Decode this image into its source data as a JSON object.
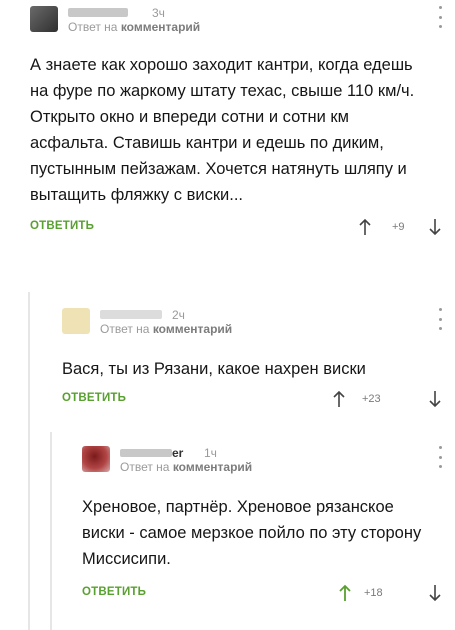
{
  "comments": [
    {
      "username": "",
      "time": "3ч",
      "reply_prefix": "Ответ на",
      "reply_target": "комментарий",
      "text": "А знаете как хорошо заходит кантри, когда едешь на фуре по жаркому штату техас, свыше 110 км/ч. Открыто окно и впереди сотни и сотни км асфальта. Ставишь кантри и едешь по диким, пустынным пейзажам. Хочется натянуть шляпу и вытащить фляжку с виски...",
      "reply_label": "ОТВЕТИТЬ",
      "score": "+9"
    },
    {
      "username": "",
      "time": "2ч",
      "reply_prefix": "Ответ на",
      "reply_target": "комментарий",
      "text": "Вася, ты из Рязани, какое нахрен виски",
      "reply_label": "ОТВЕТИТЬ",
      "score": "+23"
    },
    {
      "username": "er",
      "time": "1ч",
      "reply_prefix": "Ответ на",
      "reply_target": "комментарий",
      "text": "Хреновое, партнёр. Хреновое рязанское виски - самое мерзкое пойло по эту сторону Миссисипи.",
      "reply_label": "ОТВЕТИТЬ",
      "score": "+18"
    }
  ],
  "colors": {
    "reply_green": "#58a02f",
    "meta_gray": "#9a9a9a",
    "thread_line": "#e6e6e6"
  }
}
